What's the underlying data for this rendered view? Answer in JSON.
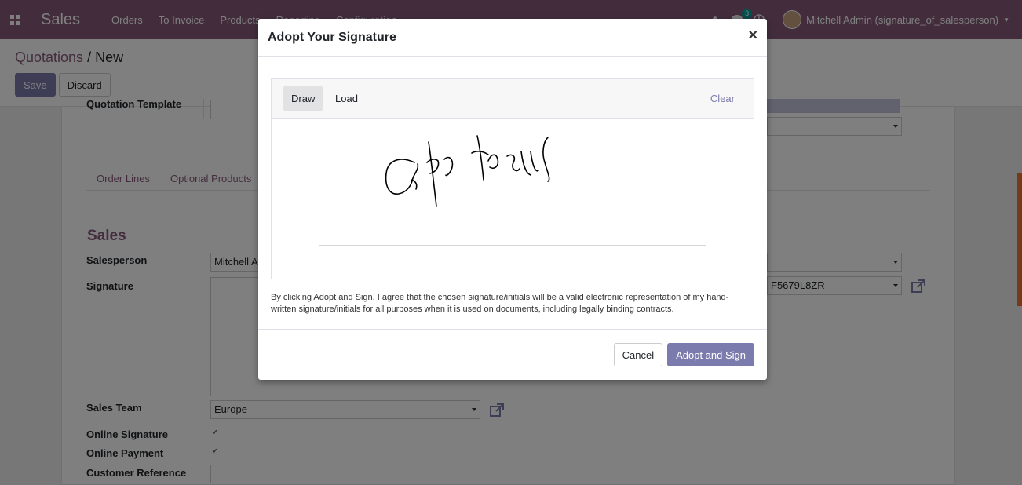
{
  "navbar": {
    "app_name": "Sales",
    "menu": [
      "Orders",
      "To Invoice",
      "Products",
      "Reporting",
      "Configuration"
    ],
    "message_count": "3",
    "user": "Mitchell Admin (signature_of_salesperson)"
  },
  "control_panel": {
    "breadcrumb_parent": "Quotations",
    "breadcrumb_sep": "/",
    "breadcrumb_current": "New",
    "save_label": "Save",
    "discard_label": "Discard"
  },
  "form": {
    "quotation_template_label": "Quotation Template",
    "tabs": [
      "Order Lines",
      "Optional Products"
    ],
    "section_sales": "Sales",
    "salesperson_label": "Salesperson",
    "salesperson_value": "Mitchell A",
    "signature_label": "Signature",
    "sales_team_label": "Sales Team",
    "sales_team_value": "Europe",
    "online_signature_label": "Online Signature",
    "online_payment_label": "Online Payment",
    "customer_reference_label": "Customer Reference",
    "right_field_value": "F5679L8ZR"
  },
  "modal": {
    "title": "Adopt Your Signature",
    "close": "×",
    "tab_draw": "Draw",
    "tab_load": "Load",
    "clear": "Clear",
    "legal_text": "By clicking Adopt and Sign, I agree that the chosen signature/initials will be a valid electronic representation of my hand-written signature/initials for all purposes when it is used on documents, including legally binding contracts.",
    "cancel": "Cancel",
    "adopt": "Adopt and Sign"
  },
  "colors": {
    "brand": "#875a7b",
    "primary": "#7c7bad"
  }
}
